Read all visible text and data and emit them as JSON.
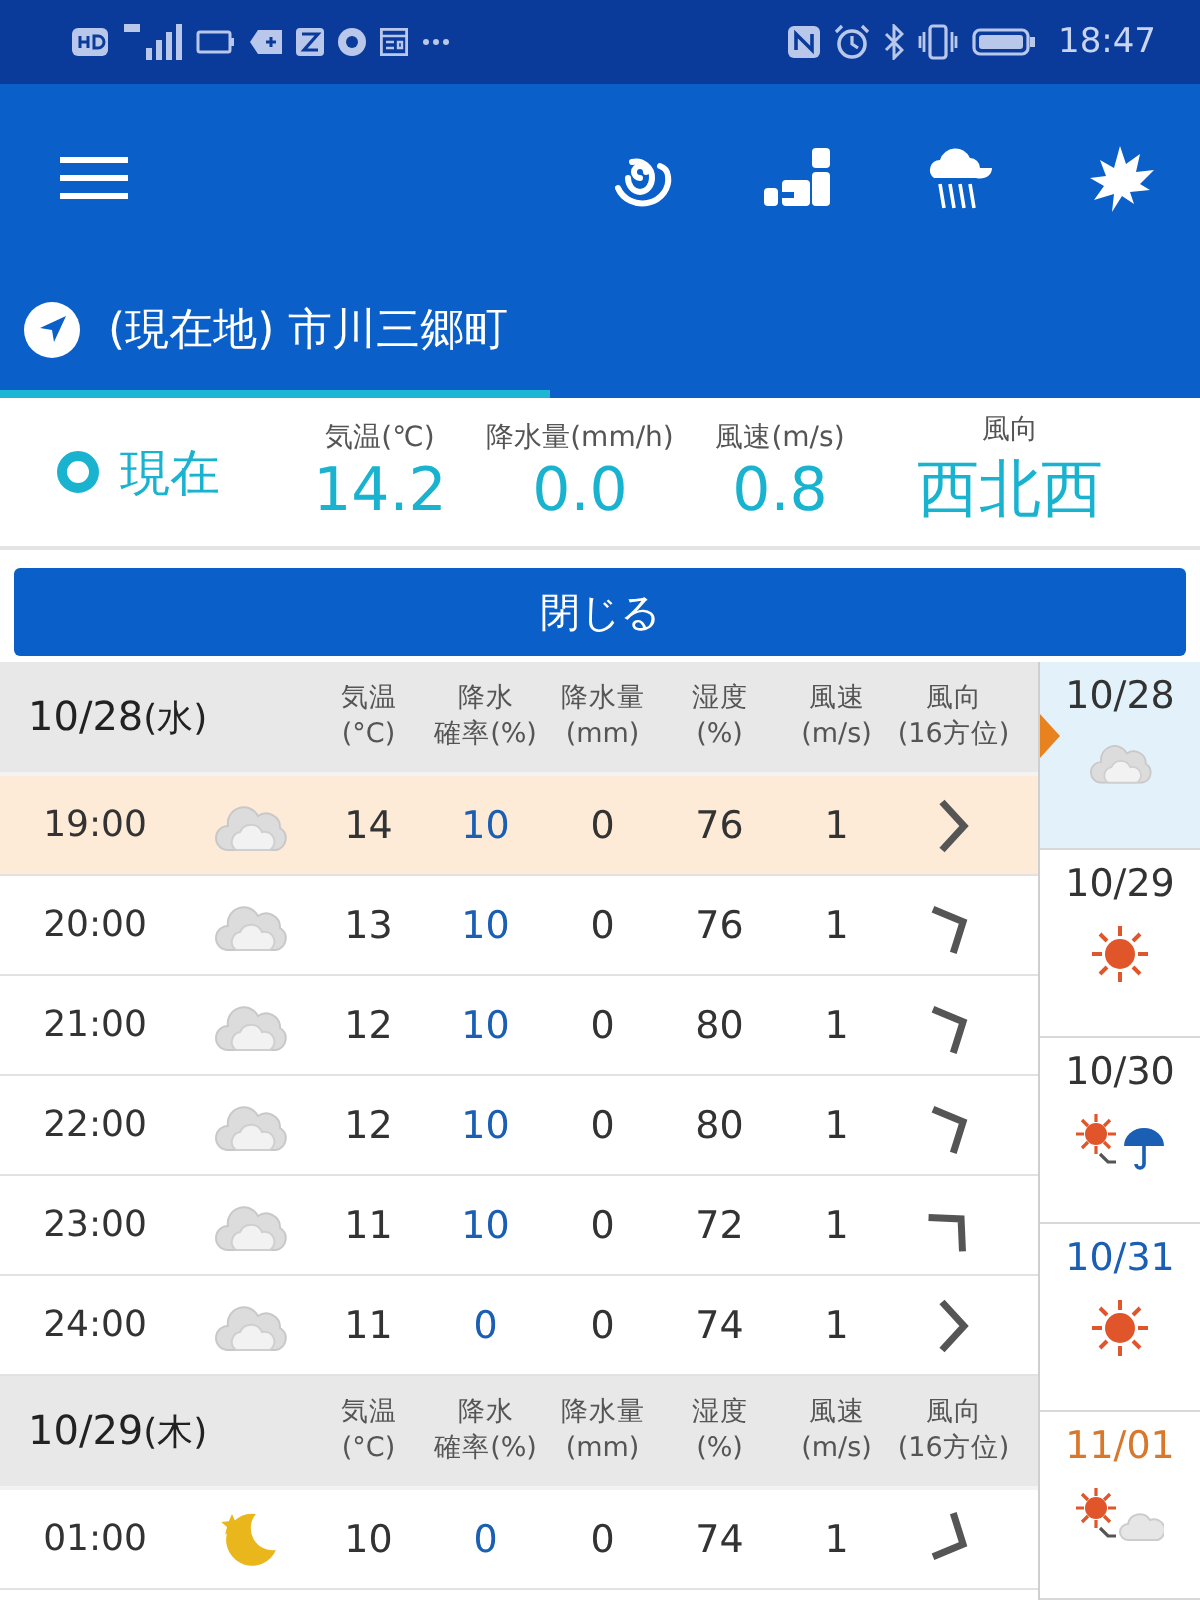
{
  "status_bar": {
    "time": "18:47"
  },
  "location": {
    "label": "(現在地) 市川三郷町"
  },
  "current": {
    "label": "現在",
    "readings": [
      {
        "label": "気温(℃)",
        "value": "14.2",
        "kind": "number"
      },
      {
        "label": "降水量(mm/h)",
        "value": "0.0",
        "kind": "number"
      },
      {
        "label": "風速(m/s)",
        "value": "0.8",
        "kind": "number"
      },
      {
        "label": "風向",
        "value": "西北西",
        "kind": "text"
      }
    ]
  },
  "close_button": {
    "label": "閉じる"
  },
  "days": [
    {
      "date": "10/28",
      "weekday": "(水)",
      "columns": [
        [
          "気温",
          "(°C)"
        ],
        [
          "降水",
          "確率(%)"
        ],
        [
          "降水量",
          "(mm)"
        ],
        [
          "湿度",
          "(%)"
        ],
        [
          "風速",
          "(m/s)"
        ],
        [
          "風向",
          "(16方位)"
        ]
      ],
      "rows": [
        {
          "time": "19:00",
          "icon": {
            "kind": "cloudy"
          },
          "temp": "14",
          "pop": "10",
          "precip": "0",
          "humidity": "76",
          "wind": "1",
          "wind_arrow": {
            "kind": "W"
          },
          "selected": true
        },
        {
          "time": "20:00",
          "icon": {
            "kind": "cloudy"
          },
          "temp": "13",
          "pop": "10",
          "precip": "0",
          "humidity": "76",
          "wind": "1",
          "wind_arrow": {
            "kind": "WNW"
          },
          "selected": false
        },
        {
          "time": "21:00",
          "icon": {
            "kind": "cloudy"
          },
          "temp": "12",
          "pop": "10",
          "precip": "0",
          "humidity": "80",
          "wind": "1",
          "wind_arrow": {
            "kind": "WNW"
          },
          "selected": false
        },
        {
          "time": "22:00",
          "icon": {
            "kind": "cloudy"
          },
          "temp": "12",
          "pop": "10",
          "precip": "0",
          "humidity": "80",
          "wind": "1",
          "wind_arrow": {
            "kind": "WNW"
          },
          "selected": false
        },
        {
          "time": "23:00",
          "icon": {
            "kind": "cloudy"
          },
          "temp": "11",
          "pop": "10",
          "precip": "0",
          "humidity": "72",
          "wind": "1",
          "wind_arrow": {
            "kind": "NW"
          },
          "selected": false
        },
        {
          "time": "24:00",
          "icon": {
            "kind": "cloudy"
          },
          "temp": "11",
          "pop": "0",
          "precip": "0",
          "humidity": "74",
          "wind": "1",
          "wind_arrow": {
            "kind": "W"
          },
          "selected": false
        }
      ]
    },
    {
      "date": "10/29",
      "weekday": "(木)",
      "columns": [
        [
          "気温",
          "(°C)"
        ],
        [
          "降水",
          "確率(%)"
        ],
        [
          "降水量",
          "(mm)"
        ],
        [
          "湿度",
          "(%)"
        ],
        [
          "風速",
          "(m/s)"
        ],
        [
          "風向",
          "(16方位)"
        ]
      ],
      "rows": [
        {
          "time": "01:00",
          "icon": {
            "kind": "moon"
          },
          "temp": "10",
          "pop": "0",
          "precip": "0",
          "humidity": "74",
          "wind": "1",
          "wind_arrow": {
            "kind": "WSW"
          },
          "selected": false
        }
      ]
    }
  ],
  "sidebar": [
    {
      "date": "10/28",
      "color": "#333333",
      "icon": {
        "kind": "cloudy"
      },
      "selected": true
    },
    {
      "date": "10/29",
      "color": "#333333",
      "icon": {
        "kind": "sunny"
      },
      "selected": false
    },
    {
      "date": "10/30",
      "color": "#333333",
      "icon": {
        "kind": "sun_then_rain"
      },
      "selected": false
    },
    {
      "date": "10/31",
      "color": "#1a5fb4",
      "icon": {
        "kind": "sunny"
      },
      "selected": false
    },
    {
      "date": "11/01",
      "color": "#d9772b",
      "icon": {
        "kind": "sun_then_cloud"
      },
      "selected": false
    }
  ]
}
